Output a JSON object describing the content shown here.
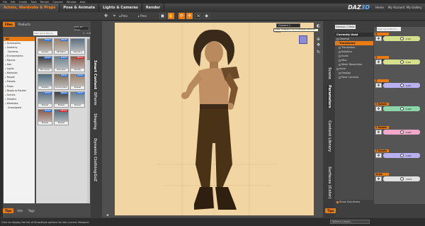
{
  "menubar": [
    "File",
    "Edit",
    "Create",
    "Tools",
    "Render",
    "Connect",
    "Window",
    "Help"
  ],
  "room_tabs": [
    "Actors, Wardrobe & Props",
    "Pose & Animate",
    "Lights & Cameras",
    "Render"
  ],
  "top_right": {
    "logo_main": "DAZ",
    "logo_accent": "3D",
    "home": "Home",
    "account": "My Account",
    "gallery": "My Gallery"
  },
  "toolbar": {
    "prev": "◂ Prev",
    "next": "▸ Prev"
  },
  "left_panel": {
    "tabs": [
      "Files",
      "Products"
    ],
    "filter_placeholder": "Enter text to filter by...",
    "store": "DAZ 3D Store",
    "count": "1 - 110",
    "categories": [
      "All",
      "Accessories",
      "Anatomy",
      "Cameras",
      "Environments",
      "Figures",
      "Hair",
      "Lights",
      "Materials",
      "People",
      "Presets",
      "Props",
      "Ready to Render",
      "Scenes",
      "Shaders",
      "Wardrobe",
      "Unassigned"
    ],
    "thumbs": [
      {
        "label": "Genesis",
        "badge": "PRESET"
      },
      {
        "label": "Michael 4",
        "badge": "PRESET"
      },
      {
        "label": "Victoria 4",
        "badge": ""
      },
      {
        "label": "Box Scene",
        "badge": "PRESET"
      },
      {
        "label": "Pose Pack",
        "badge": "PRESET"
      },
      {
        "label": "Bundle",
        "badge": "SPECIAL"
      },
      {
        "label": "Shaders",
        "badge": ""
      },
      {
        "label": "Environment",
        "badge": "PRESET"
      },
      {
        "label": "Preload",
        "badge": "PRESET"
      },
      {
        "label": "Preload",
        "badge": "PRESET"
      },
      {
        "label": "Preload",
        "badge": "PRESET"
      },
      {
        "label": "Preload",
        "badge": "PRESET"
      },
      {
        "label": "Preload",
        "badge": "PRESET"
      },
      {
        "label": "Preload",
        "badge": "SPECIAL"
      }
    ],
    "bottom_tabs": [
      "Tips",
      "Info",
      "Tags"
    ],
    "side_tabs": [
      "Smart Content",
      "DForm",
      "Shaping",
      "Dynamic Clothing",
      "GoZ"
    ]
  },
  "viewport": {
    "camera": "Camera 1",
    "tooltip": "View: Displays the DrawStyle Options menu"
  },
  "right_panel": {
    "side_tabs": [
      "Scene",
      "Parameters",
      "Content Library",
      "Surfaces (Color)"
    ],
    "figure": "Genesis 2 Male",
    "search_placeholder": "Enter text to filter by...",
    "tree": [
      {
        "label": "Currently Used",
        "kind": "head"
      },
      {
        "label": "General",
        "kind": "item"
      },
      {
        "label": "Transforms",
        "kind": "sel"
      },
      {
        "label": "Translation",
        "kind": "sub"
      },
      {
        "label": "Rotation",
        "kind": "sub"
      },
      {
        "label": "Scale",
        "kind": "sub"
      },
      {
        "label": "Misc",
        "kind": "sub"
      },
      {
        "label": "Mesh Resolution",
        "kind": "sub"
      },
      {
        "label": "Actor",
        "kind": "item"
      },
      {
        "label": "Display",
        "kind": "sub"
      },
      {
        "label": "Pose Controls",
        "kind": "sub"
      }
    ],
    "params": [
      {
        "label": "X Translate",
        "value": "0.00",
        "color": "#d4e08c"
      },
      {
        "label": "Y Translate",
        "value": "0.00",
        "color": "#d4e08c"
      },
      {
        "label": "Z Translate",
        "value": "0.00",
        "color": "#b8b0f0"
      },
      {
        "label": "X Rotate",
        "value": "0.00°",
        "color": "#8ad6a8"
      },
      {
        "label": "Y Rotate",
        "value": "0.00°",
        "color": "#f0a8c8"
      },
      {
        "label": "Z Rotate",
        "value": "0.00°",
        "color": "#b8b0f0"
      },
      {
        "label": "Scale",
        "value": "100%",
        "color": "#e0e0e0"
      }
    ],
    "show_subitems": "Show Sub-Items",
    "bottom_tabs": [
      "Tips"
    ]
  },
  "status": {
    "text": "Click to display the list of DrawStyle options for the current Viewport",
    "lesson": "Select a Lesson..."
  }
}
